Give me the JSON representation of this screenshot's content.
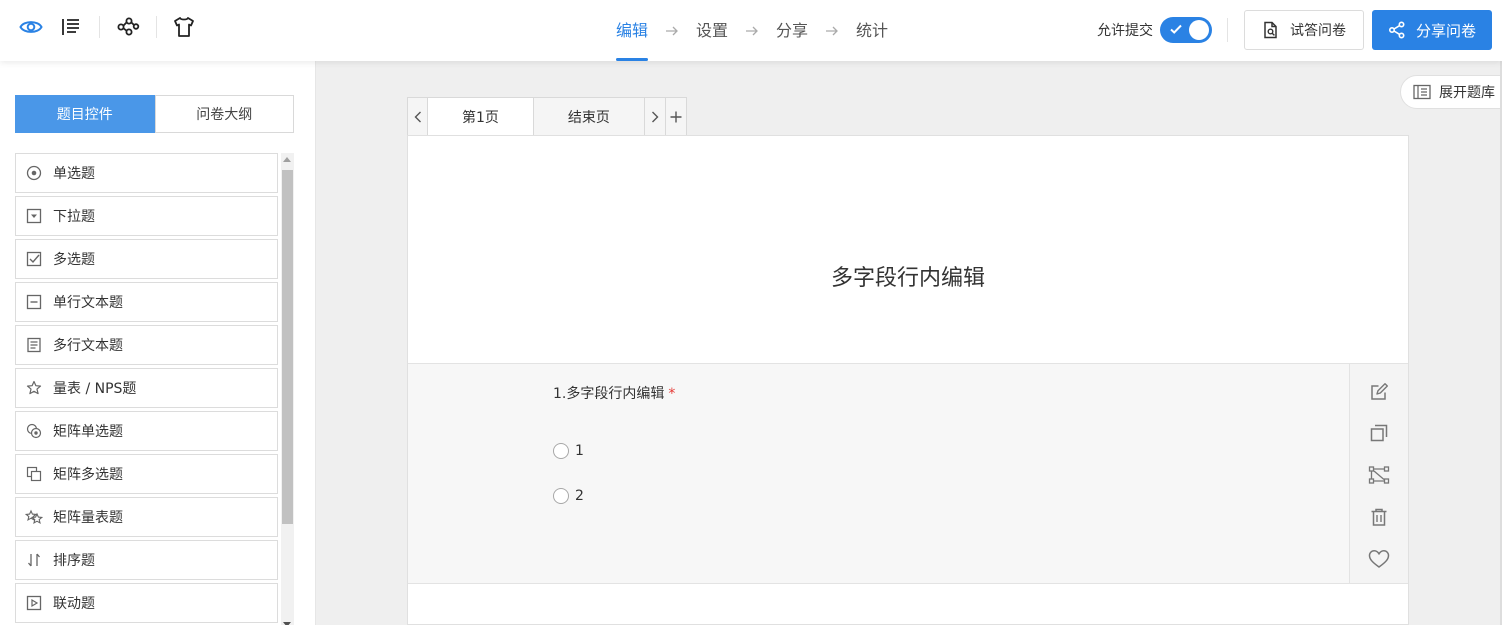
{
  "header": {
    "icons": [
      "eye-icon",
      "outline-list-icon",
      "logic-flow-icon",
      "tshirt-theme-icon"
    ],
    "steps": [
      {
        "label": "编辑",
        "active": true
      },
      {
        "label": "设置",
        "active": false
      },
      {
        "label": "分享",
        "active": false
      },
      {
        "label": "统计",
        "active": false
      }
    ],
    "allow_submit_label": "允许提交",
    "allow_submit_on": true,
    "try_button": "试答问卷",
    "share_button": "分享问卷",
    "accent_color": "#2a82e4"
  },
  "left_panel": {
    "tabs": [
      {
        "label": "题目控件",
        "active": true
      },
      {
        "label": "问卷大纲",
        "active": false
      }
    ],
    "question_types": [
      {
        "label": "单选题",
        "icon": "radio-icon"
      },
      {
        "label": "下拉题",
        "icon": "dropdown-icon"
      },
      {
        "label": "多选题",
        "icon": "checkbox-icon"
      },
      {
        "label": "单行文本题",
        "icon": "single-line-text-icon"
      },
      {
        "label": "多行文本题",
        "icon": "multi-line-text-icon"
      },
      {
        "label": "量表 / NPS题",
        "icon": "star-icon"
      },
      {
        "label": "矩阵单选题",
        "icon": "matrix-radio-icon"
      },
      {
        "label": "矩阵多选题",
        "icon": "matrix-checkbox-icon"
      },
      {
        "label": "矩阵量表题",
        "icon": "matrix-star-icon"
      },
      {
        "label": "排序题",
        "icon": "sort-icon"
      },
      {
        "label": "联动题",
        "icon": "cascade-icon"
      }
    ]
  },
  "editor": {
    "page_tabs": [
      {
        "label": "第1页",
        "active": true
      },
      {
        "label": "结束页",
        "active": false
      }
    ],
    "survey_title": "多字段行内编辑",
    "question": {
      "title": "1.多字段行内编辑",
      "required_mark": "*",
      "options": [
        "1",
        "2"
      ]
    },
    "question_tools": [
      "edit-icon",
      "copy-icon",
      "logic-icon",
      "delete-icon",
      "favorite-icon"
    ],
    "library_button": "展开题库"
  }
}
